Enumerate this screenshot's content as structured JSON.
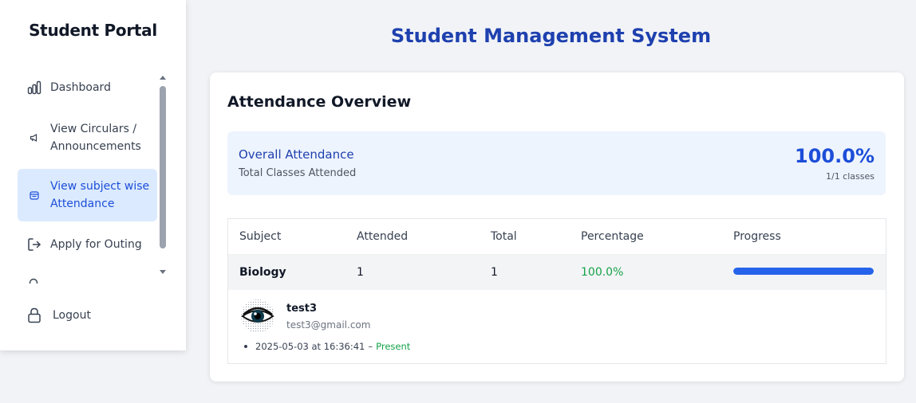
{
  "sidebar": {
    "brand": "Student Portal",
    "items": [
      {
        "label": "Dashboard",
        "icon": "bar-chart-icon",
        "active": false
      },
      {
        "label_line1": "View Circulars /",
        "label_line2": "Announcements",
        "icon": "megaphone-icon",
        "active": false
      },
      {
        "label_line1": "View subject wise",
        "label_line2": "Attendance",
        "icon": "calendar-icon",
        "active": true
      },
      {
        "label": "Apply for Outing",
        "icon": "exit-icon",
        "active": false
      }
    ],
    "logout": {
      "label": "Logout",
      "icon": "lock-icon"
    }
  },
  "header": {
    "title": "Student Management System"
  },
  "attendance": {
    "title": "Attendance Overview",
    "overall": {
      "title": "Overall Attendance",
      "subtitle": "Total Classes Attended",
      "percentage": "100.0%",
      "classes": "1/1 classes"
    },
    "table": {
      "columns": [
        "Subject",
        "Attended",
        "Total",
        "Percentage",
        "Progress"
      ],
      "rows": [
        {
          "subject": "Biology",
          "attended": "1",
          "total": "1",
          "percentage": "100.0%",
          "progress": 1.0
        }
      ]
    },
    "detail": {
      "user": {
        "name": "test3",
        "email": "test3@gmail.com"
      },
      "record": {
        "datetime": "2025-05-03 at 16:36:41",
        "separator": "–",
        "status": "Present"
      }
    }
  },
  "colors": {
    "accent": "#1e40af",
    "active_bg": "#dbeafe",
    "progress": "#2563eb",
    "present": "#16a34a"
  }
}
